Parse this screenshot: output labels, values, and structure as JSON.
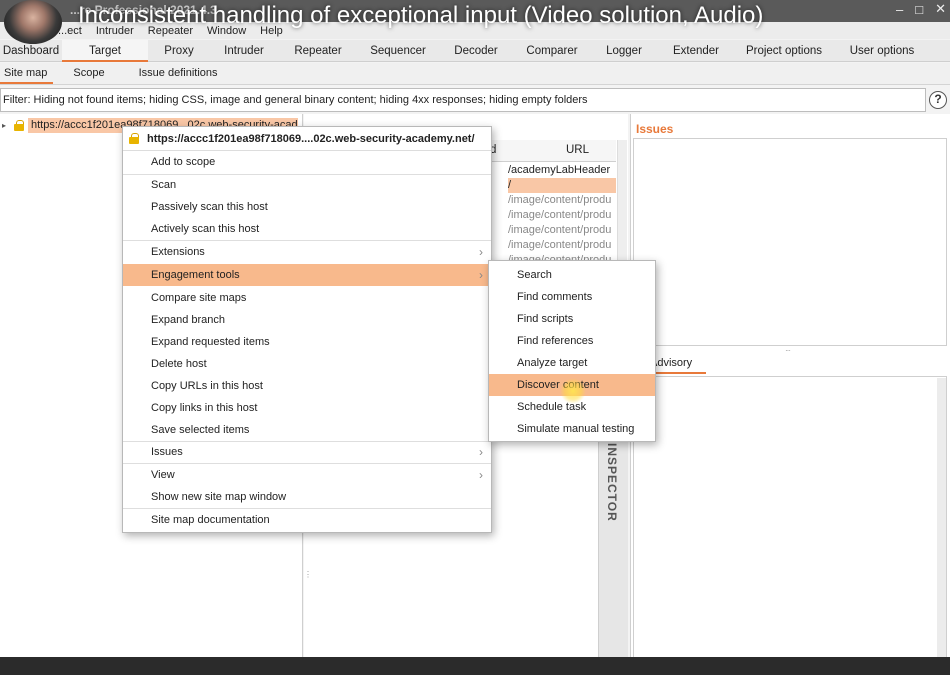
{
  "window": {
    "app_title": "...re Professional 2021.4.3",
    "controls": [
      "–",
      "□",
      "✕"
    ]
  },
  "video": {
    "title": "Inconsistent handling of exceptional input (Video solution, Audio)"
  },
  "menubar": [
    "...ect",
    "Intruder",
    "Repeater",
    "Window",
    "Help"
  ],
  "main_tabs": [
    "Dashboard",
    "Target",
    "Proxy",
    "Intruder",
    "Repeater",
    "Sequencer",
    "Decoder",
    "Comparer",
    "Logger",
    "Extender",
    "Project options",
    "User options"
  ],
  "main_tabs_active": "Target",
  "sub_tabs": [
    "Site map",
    "Scope",
    "Issue definitions"
  ],
  "sub_tabs_active": "Site map",
  "filter": {
    "text": "Filter: Hiding not found items;  hiding CSS, image and general binary content;  hiding 4xx responses;  hiding empty folders"
  },
  "help": {
    "label": "?"
  },
  "tree": {
    "twist": "▸",
    "url": "https://accc1f201ea98f718069...02c.web-security-academy.net"
  },
  "table": {
    "col_method": "d",
    "col_url": "URL",
    "rows": [
      "/academyLabHeader",
      "/",
      "/image/content/produ",
      "/image/content/produ",
      "/image/content/produ",
      "/image/content/produ",
      "/image/content/produ"
    ]
  },
  "inspector": {
    "label": "INSPECTOR"
  },
  "issues": {
    "title": "Issues"
  },
  "advisory": {
    "tab": "Advisory"
  },
  "context_menu": {
    "header": "https://accc1f201ea98f718069....02c.web-security-academy.net/",
    "items": [
      "Add to scope",
      "Scan",
      "Passively scan this host",
      "Actively scan this host",
      "Extensions",
      "Engagement tools",
      "Compare site maps",
      "Expand branch",
      "Expand requested items",
      "Delete host",
      "Copy URLs in this host",
      "Copy links in this host",
      "Save selected items",
      "Issues",
      "View",
      "Show new site map window",
      "Site map documentation"
    ],
    "submenu_arrow": "›",
    "highlighted": "Engagement tools"
  },
  "submenu": {
    "items": [
      "Search",
      "Find comments",
      "Find scripts",
      "Find references",
      "Analyze target",
      "Discover content",
      "Schedule task",
      "Simulate manual testing"
    ],
    "highlighted": "Discover content"
  },
  "colors": {
    "accent": "#e8793a",
    "highlight": "#f8b98c",
    "selection": "#f9c7a6"
  }
}
